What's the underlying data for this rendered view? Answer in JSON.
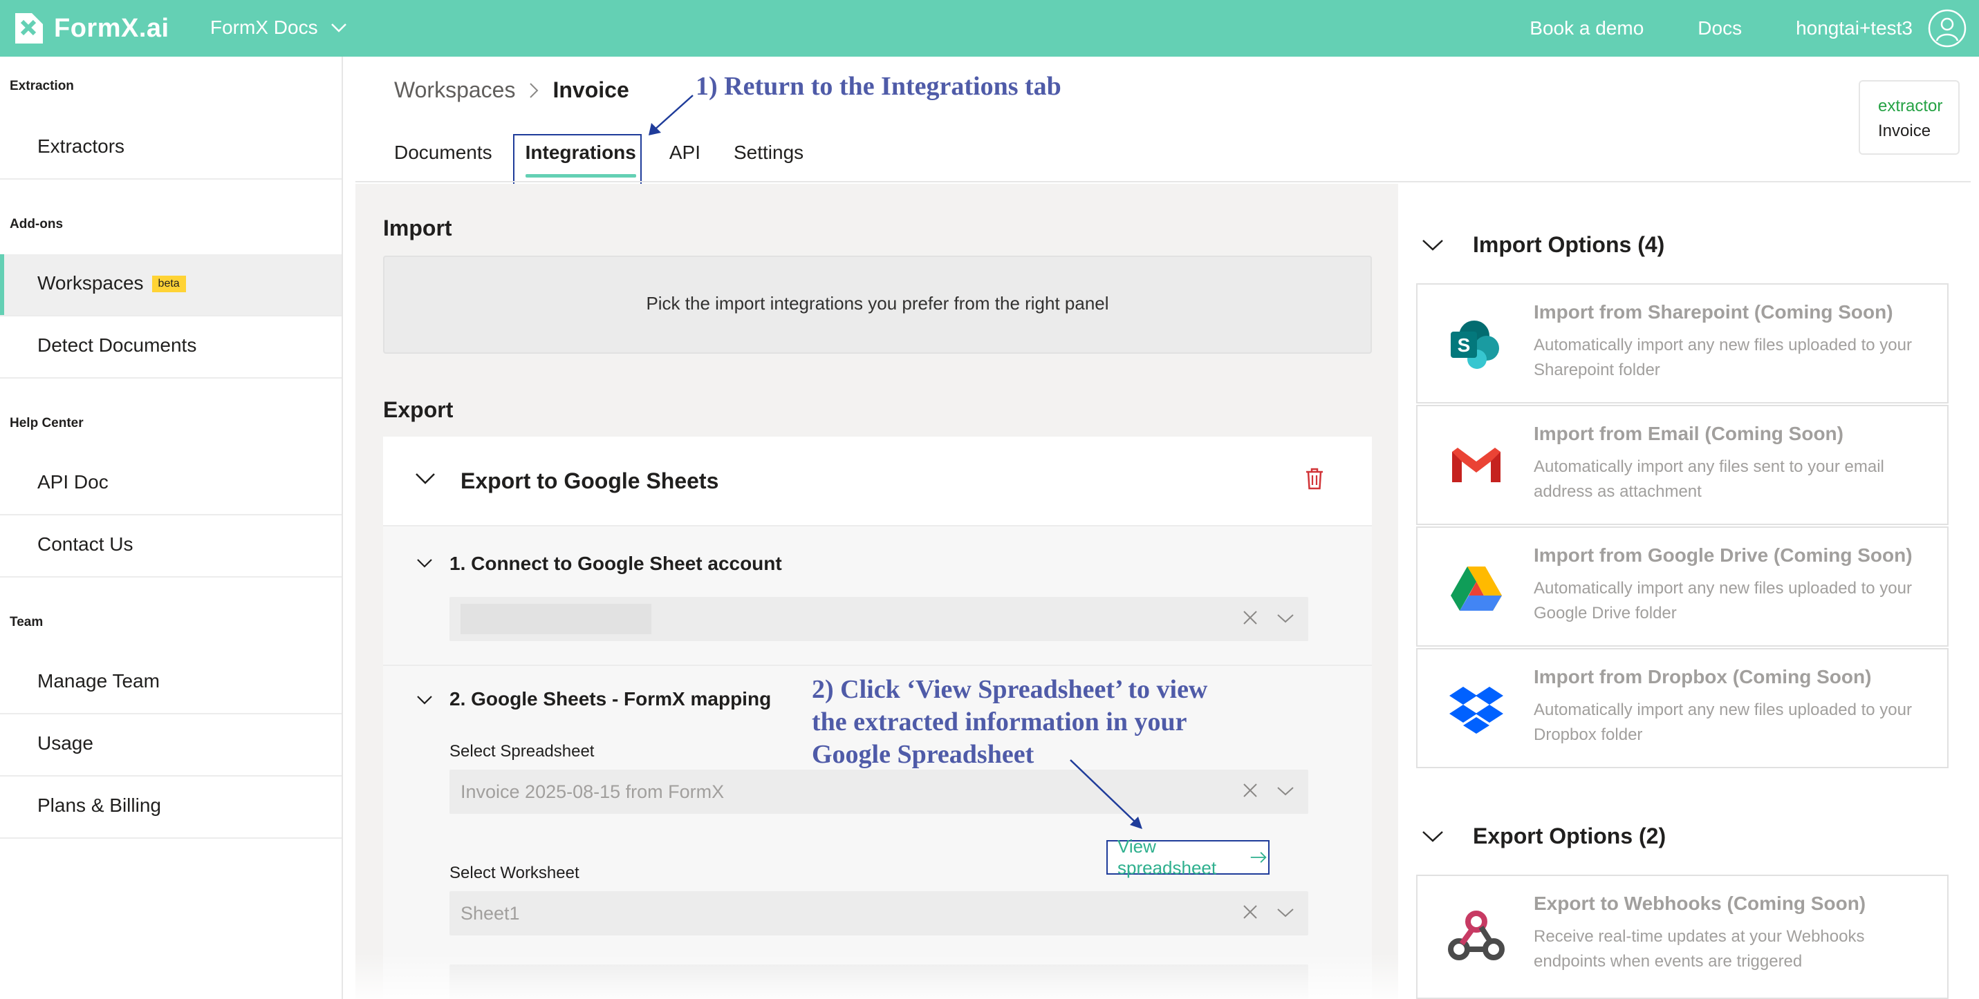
{
  "topbar": {
    "brand": "FormX.ai",
    "docs_select": "FormX Docs",
    "links": [
      "Book a demo",
      "Docs"
    ],
    "user": "hongtai+test3",
    "bg_color": "#64d0b4"
  },
  "sidebar": {
    "sections": [
      {
        "heading": "Extraction",
        "items": [
          {
            "label": "Extractors"
          }
        ]
      },
      {
        "heading": "Add-ons",
        "items": [
          {
            "label": "Workspaces",
            "badge": "beta",
            "active": true
          },
          {
            "label": "Detect Documents"
          }
        ]
      },
      {
        "heading": "Help Center",
        "items": [
          {
            "label": "API Doc"
          },
          {
            "label": "Contact Us"
          }
        ]
      },
      {
        "heading": "Team",
        "items": [
          {
            "label": "Manage Team"
          },
          {
            "label": "Usage"
          },
          {
            "label": "Plans & Billing"
          }
        ]
      }
    ]
  },
  "breadcrumb": {
    "parent": "Workspaces",
    "current": "Invoice"
  },
  "tabs": [
    "Documents",
    "Integrations",
    "API",
    "Settings"
  ],
  "active_tab": "Integrations",
  "extractor_card": {
    "key": "extractor",
    "value": "Invoice"
  },
  "annotations": {
    "a1": "1) Return to the Integrations tab",
    "a2_lines": [
      "2) Click ‘View Spreadsheet’ to view",
      "the extracted information in your",
      "Google Spreadsheet"
    ]
  },
  "import": {
    "title": "Import",
    "placeholder": "Pick the import integrations you prefer from the right panel"
  },
  "export": {
    "title": "Export",
    "card_title": "Export to Google Sheets",
    "step1": {
      "title": "1. Connect to Google Sheet account"
    },
    "step2": {
      "title": "2. Google Sheets - FormX mapping",
      "spreadsheet_label": "Select Spreadsheet",
      "spreadsheet_value": "Invoice 2025-08-15 from FormX",
      "view_button": "View spreadsheet",
      "worksheet_label": "Select Worksheet",
      "worksheet_value": "Sheet1"
    }
  },
  "import_options": {
    "title": "Import Options (4)",
    "items": [
      {
        "icon": "sharepoint-icon",
        "title": "Import from Sharepoint (Coming Soon)",
        "desc": "Automatically import any new files uploaded to your Sharepoint folder"
      },
      {
        "icon": "gmail-icon",
        "title": "Import from Email (Coming Soon)",
        "desc": "Automatically import any files sent to your email address as attachment"
      },
      {
        "icon": "google-drive-icon",
        "title": "Import from Google Drive (Coming Soon)",
        "desc": "Automatically import any new files uploaded to your Google Drive folder"
      },
      {
        "icon": "dropbox-icon",
        "title": "Import from Dropbox (Coming Soon)",
        "desc": "Automatically import any new files uploaded to your Dropbox folder"
      }
    ]
  },
  "export_options": {
    "title": "Export Options (2)",
    "items": [
      {
        "icon": "webhooks-icon",
        "title": "Export to Webhooks (Coming Soon)",
        "desc": "Receive real-time updates at your Webhooks endpoints when events are triggered"
      }
    ]
  },
  "colors": {
    "accent": "#64d0b4",
    "annotation": "#4f5ba8",
    "annotation_box": "#1f3c9a",
    "danger": "#d13438"
  }
}
